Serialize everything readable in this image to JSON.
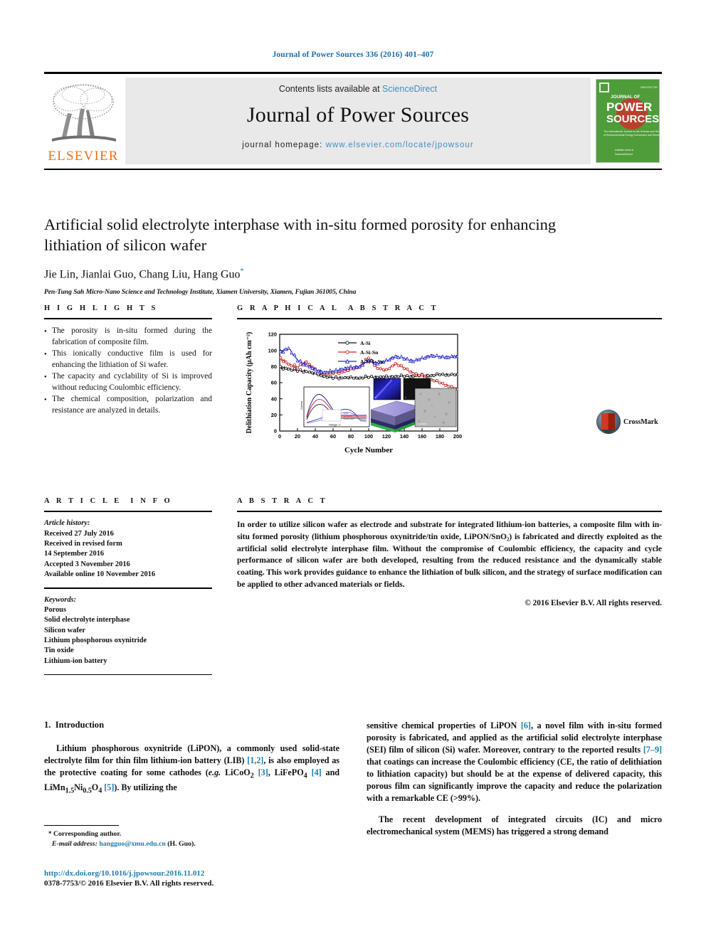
{
  "running_head": "Journal of Power Sources 336 (2016) 401–407",
  "masthead": {
    "contents_prefix": "Contents lists available at ",
    "contents_link": "ScienceDirect",
    "journal_name": "Journal of Power Sources",
    "homepage_label": "journal homepage: ",
    "homepage_url": "www.elsevier.com/locate/jpowsour",
    "publisher_logo_text": "ELSEVIER",
    "publisher_logo_icon": "elsevier-tree-icon",
    "cover_title_line1": "JOURNAL OF",
    "cover_title_line2": "POWER",
    "cover_title_line3": "SOURCES"
  },
  "article": {
    "title": "Artificial solid electrolyte interphase with in-situ formed porosity for enhancing lithiation of silicon wafer",
    "authors": "Jie Lin, Jianlai Guo, Chang Liu, Hang Guo",
    "author_marker": "*",
    "affiliation": "Pen-Tung Sah Micro-Nano Science and Technology Institute, Xiamen University, Xiamen, Fujian 361005, China",
    "crossmark_label": "CrossMark"
  },
  "highlights": {
    "heading": "HIGHLIGHTS",
    "items": [
      "The porosity is in-situ formed during the fabrication of composite film.",
      "This ionically conductive film is used for enhancing the lithiation of Si wafer.",
      "The capacity and cyclability of Si is improved without reducing Coulombic efficiency.",
      "The chemical composition, polarization and resistance are analyzed in details."
    ]
  },
  "graphical_abstract": {
    "heading": "GRAPHICAL ABSTRACT"
  },
  "chart_data": {
    "type": "line",
    "title": "",
    "xlabel": "Cycle Number",
    "ylabel": "Delithiation Capacity (µAh cm⁻²)",
    "xlim": [
      0,
      200
    ],
    "ylim": [
      0,
      120
    ],
    "xticks": [
      0,
      20,
      40,
      60,
      80,
      100,
      120,
      140,
      160,
      180,
      200
    ],
    "yticks": [
      0,
      20,
      40,
      60,
      80,
      100,
      120
    ],
    "grid": false,
    "legend_position": "top-center",
    "series": [
      {
        "name": "A-Si",
        "color": "#111111",
        "marker": "circle-open",
        "x": [
          1,
          10,
          20,
          30,
          40,
          50,
          60,
          70,
          80,
          90,
          100,
          110,
          120,
          130,
          140,
          150,
          160,
          170,
          180,
          190,
          200
        ],
        "values": [
          79,
          77,
          75,
          74,
          71,
          68,
          66,
          66,
          66,
          66,
          67,
          67,
          67,
          68,
          68,
          68,
          69,
          69,
          70,
          70,
          70
        ]
      },
      {
        "name": "A-Si-Sn",
        "color": "#cc2222",
        "marker": "circle-open",
        "x": [
          1,
          10,
          20,
          30,
          40,
          50,
          60,
          70,
          80,
          90,
          100,
          110,
          120,
          130,
          140,
          150,
          160,
          170,
          180,
          190,
          200
        ],
        "values": [
          90,
          83,
          79,
          86,
          76,
          71,
          72,
          73,
          76,
          80,
          91,
          78,
          75,
          84,
          78,
          72,
          68,
          64,
          60,
          56,
          52
        ]
      },
      {
        "name": "A-Si-L-Sn",
        "color": "#2222cc",
        "marker": "triangle-open",
        "x": [
          1,
          10,
          20,
          30,
          40,
          50,
          60,
          70,
          80,
          90,
          100,
          110,
          120,
          130,
          140,
          150,
          160,
          170,
          180,
          190,
          200
        ],
        "values": [
          98,
          103,
          88,
          82,
          76,
          73,
          74,
          77,
          79,
          80,
          88,
          84,
          87,
          93,
          90,
          87,
          90,
          94,
          92,
          92,
          93
        ]
      }
    ],
    "inset": {
      "type": "line",
      "xlabel": "Voltage, V",
      "ylabel": "Current, mA",
      "legend": [
        "A-Si",
        "A-Si-Sn",
        "A-Si-L-Sn"
      ]
    },
    "inset_images": [
      "sem-mapping-blue",
      "sem-mapping-dark",
      "film-stack-schematic",
      "sem-surface-grey"
    ]
  },
  "article_info": {
    "heading": "ARTICLE INFO",
    "history_label": "Article history:",
    "history": [
      "Received 27 July 2016",
      "Received in revised form",
      "14 September 2016",
      "Accepted 3 November 2016",
      "Available online 10 November 2016"
    ],
    "keywords_label": "Keywords:",
    "keywords": [
      "Porous",
      "Solid electrolyte interphase",
      "Silicon wafer",
      "Lithium phosphorous oxynitride",
      "Tin oxide",
      "Lithium-ion battery"
    ]
  },
  "abstract": {
    "heading": "ABSTRACT",
    "text": "In order to utilize silicon wafer as electrode and substrate for integrated lithium-ion batteries, a composite film with in-situ formed porosity (lithium phosphorous oxynitride/tin oxide, LiPON/SnO₂) is fabricated and directly exploited as the artificial solid electrolyte interphase film. Without the compromise of Coulombic efficiency, the capacity and cycle performance of silicon wafer are both developed, resulting from the reduced resistance and the dynamically stable coating. This work provides guidance to enhance the lithiation of bulk silicon, and the strategy of surface modification can be applied to other advanced materials or fields.",
    "copyright": "© 2016 Elsevier B.V. All rights reserved."
  },
  "body": {
    "section_number": "1.",
    "section_title": "Introduction",
    "left_para_1": {
      "t1": "Lithium phosphorous oxynitride (LiPON), a commonly used solid-state electrolyte film for thin film lithium-ion battery (LIB) ",
      "r1": "[1,2]",
      "t2": ", is also employed as the protective coating for some cathodes (",
      "i1": "e.g.",
      "t3": " LiCoO",
      "sub1": "2",
      "t4": " ",
      "r2": "[3]",
      "t5": ", LiFePO",
      "sub2": "4",
      "t6": " ",
      "r3": "[4]",
      "t7": " and LiMn",
      "sub3": "1.5",
      "t8": "Ni",
      "sub4": "0.5",
      "t9": "O",
      "sub5": "4",
      "t10": " ",
      "r4": "[5]",
      "t11": "). By utilizing the"
    },
    "right_para_1": {
      "t1": "sensitive chemical properties of LiPON ",
      "r1": "[6]",
      "t2": ", a novel film with in-situ formed porosity is fabricated, and applied as the artificial solid electrolyte interphase (SEI) film of silicon (Si) wafer. Moreover, contrary to the reported results ",
      "r2": "[7–9]",
      "t3": " that coatings can increase the Coulombic efficiency (CE, the ratio of delithiation to lithiation capacity) but should be at the expense of delivered capacity, this porous film can significantly improve the capacity and reduce the polarization with a remarkable CE (>99%)."
    },
    "right_para_2": "The recent development of integrated circuits (IC) and micro electromechanical system (MEMS) has triggered a strong demand"
  },
  "footnote": {
    "star": "*",
    "corresponding": " Corresponding author.",
    "email_label": "E-mail address:",
    "email": "hangguo@xmu.edu.cn",
    "email_suffix": " (H. Guo)."
  },
  "imprint": {
    "doi": "http://dx.doi.org/10.1016/j.jpowsour.2016.11.012",
    "issn_line": "0378-7753/© 2016 Elsevier B.V. All rights reserved."
  },
  "colors": {
    "link": "#1f7bb0",
    "elsevier_orange": "#E9711C",
    "band": "#e9e9e9",
    "cover_green": "#4f9c3a",
    "series_black": "#111111",
    "series_red": "#cc2222",
    "series_blue": "#2222cc"
  }
}
